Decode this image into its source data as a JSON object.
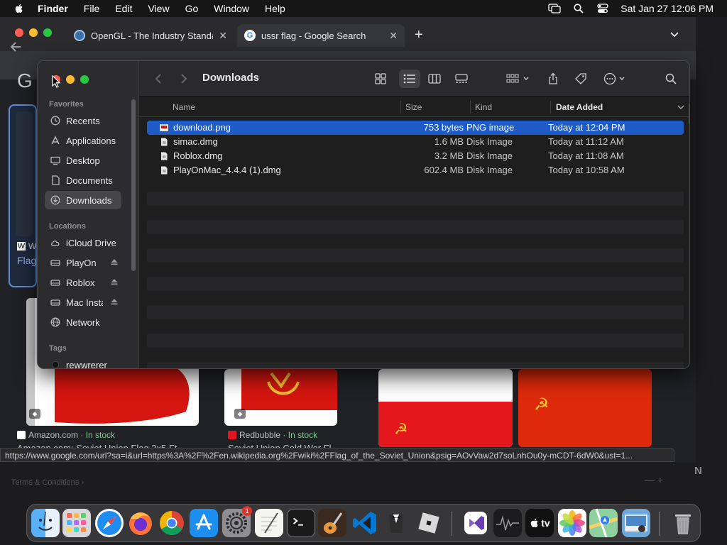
{
  "menubar": {
    "app": "Finder",
    "items": [
      "File",
      "Edit",
      "View",
      "Go",
      "Window",
      "Help"
    ],
    "clock": "Sat Jan 27  12:06 PM"
  },
  "browser": {
    "tabs": [
      {
        "title": "OpenGL - The Industry Standard"
      },
      {
        "title": "ussr flag - Google Search"
      }
    ],
    "google_logo_partial": "G",
    "left_card": {
      "w": "W",
      "source": "W",
      "title": "Flag"
    },
    "results": [
      {
        "source": "Amazon.com",
        "stock": "In stock",
        "title": "Amazon.com: Soviet Union Flag 3x5 Ft"
      },
      {
        "source": "Redbubble",
        "stock": "In stock",
        "title": "Soviet Union Cold War Fl"
      }
    ],
    "status_url": "https://www.google.com/url?sa=i&url=https%3A%2F%2Fen.wikipedia.org%2Fwiki%2FFlag_of_the_Soviet_Union&psig=AOvVaw2d7soLnhOu0y-mCDT-6dW0&ust=1...",
    "footer_terms": "Terms & Conditions",
    "footer_marks": "—   +",
    "corner_badge": "N"
  },
  "finder": {
    "title": "Downloads",
    "sidebar": {
      "favorites_header": "Favorites",
      "favorites": [
        "Recents",
        "Applications",
        "Desktop",
        "Documents",
        "Downloads"
      ],
      "locations_header": "Locations",
      "locations": [
        "iCloud Drive",
        "PlayOnMac",
        "Roblox",
        "Mac Installer",
        "Network"
      ],
      "tags_header": "Tags",
      "tags": [
        "rewwrerer"
      ]
    },
    "columns": {
      "name": "Name",
      "size": "Size",
      "kind": "Kind",
      "date": "Date Added"
    },
    "files": [
      {
        "name": "download.png",
        "size": "753 bytes",
        "kind": "PNG image",
        "date": "Today at 12:04 PM"
      },
      {
        "name": "simac.dmg",
        "size": "1.6 MB",
        "kind": "Disk Image",
        "date": "Today at 11:12 AM"
      },
      {
        "name": "Roblox.dmg",
        "size": "3.2 MB",
        "kind": "Disk Image",
        "date": "Today at 11:08 AM"
      },
      {
        "name": "PlayOnMac_4.4.4 (1).dmg",
        "size": "602.4 MB",
        "kind": "Disk Image",
        "date": "Today at 10:58 AM"
      }
    ]
  },
  "dock": {
    "apps": [
      "Finder",
      "Launchpad",
      "Safari",
      "Firefox",
      "Chrome",
      "App Store",
      "System Settings",
      "TextEdit",
      "Terminal",
      "GarageBand",
      "Visual Studio Code",
      "Bartender",
      "Roblox",
      "Visual Studio",
      "Activity Monitor",
      "Apple TV",
      "Photos",
      "Maps",
      "Preview",
      "Trash"
    ],
    "settings_badge": "1",
    "tv_label": "tv"
  },
  "colors": {
    "selection": "#1e5bc6",
    "ussr_red": "#d5150f",
    "hammer_gold": "#f2c230"
  }
}
